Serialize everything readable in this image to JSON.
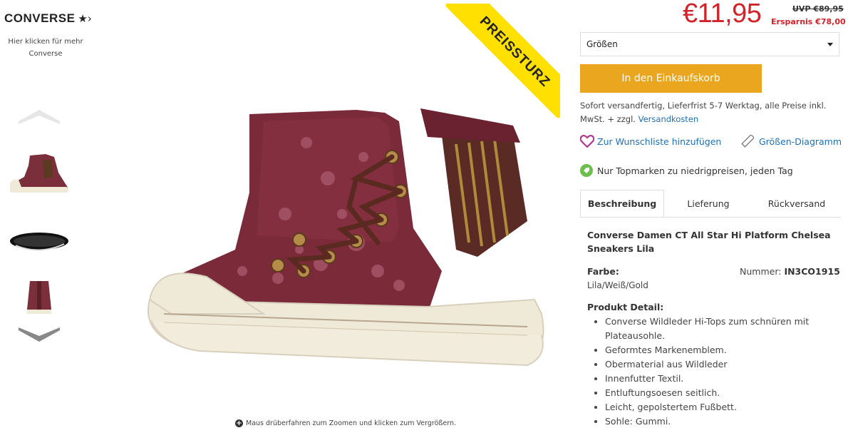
{
  "brand": {
    "name": "CONVERSE",
    "link_line1": "Hier klicken für mehr",
    "link_line2": "Converse"
  },
  "badge": {
    "text": "PREISSTURZ",
    "color": "#ffe000"
  },
  "price": {
    "current": "€11,95",
    "uvp": "UVP €89,95",
    "saving": "Ersparnis €78,00",
    "color": "#d2232a"
  },
  "size_select": {
    "selected": "Größen"
  },
  "cart_button": {
    "label": "In den Einkaufskorb",
    "color": "#e9a61e"
  },
  "shipping": {
    "text": "Sofort versandfertig, Lieferfrist 5-7 Werktag, alle Preise inkl. MwSt. + zzgl. ",
    "link": "Versandkosten"
  },
  "actions": {
    "wishlist": "Zur Wunschliste hinzufügen",
    "size_chart": "Größen-Diagramm",
    "top_brands": "Nur Topmarken zu niedrigpreisen, jeden Tag"
  },
  "tabs": [
    {
      "label": "Beschreibung"
    },
    {
      "label": "Lieferung"
    },
    {
      "label": "Rückversand"
    }
  ],
  "description": {
    "title": "Converse Damen CT All Star Hi Platform Chelsea Sneakers Lila",
    "color_label": "Farbe:",
    "color_value": "Lila/Weiß/Gold",
    "number_label": "Nummer:",
    "number_value": "IN3CO1915",
    "detail_label": "Produkt Detail:",
    "details": [
      "Converse Wildleder Hi-Tops zum schnüren mit Plateausohle.",
      "Geformtes Markenemblem.",
      "Obermaterial aus Wildleder",
      "Innenfutter Textil.",
      "Entluftungsoesen seitlich.",
      "Leicht, gepolstertem Fußbett.",
      "Sohle: Gummi."
    ]
  },
  "zoom_hint": "Maus drüberfahren zum Zoomen und klicken zum Vergrößern.",
  "icons": {
    "wishlist": "heart-icon",
    "size_chart": "ruler-icon",
    "top_brands": "tag-icon",
    "thumb_up": "chevron-up-icon",
    "thumb_down": "chevron-down-icon"
  }
}
